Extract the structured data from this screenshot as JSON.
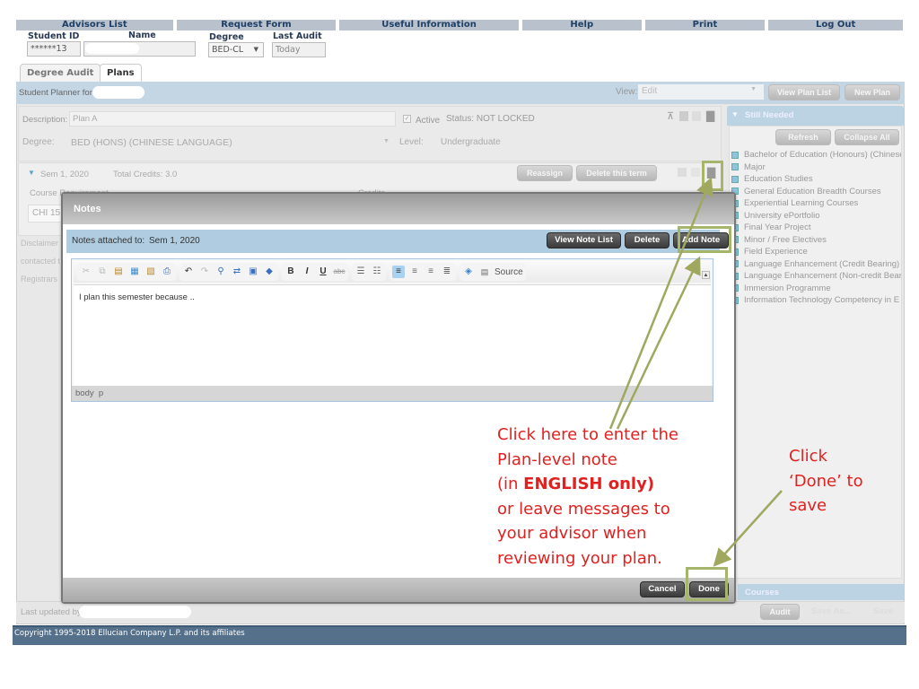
{
  "topnav": [
    "Advisors List",
    "Request Form",
    "Useful Information",
    "Help",
    "Print",
    "Log Out"
  ],
  "student": {
    "id_label": "Student ID",
    "id_value": "******13",
    "name_label": "Name",
    "degree_label": "Degree",
    "degree_value": "BED-CL",
    "last_audit_label": "Last Audit",
    "last_audit_value": "Today"
  },
  "tabs": [
    {
      "label": "Degree Audit",
      "active": false
    },
    {
      "label": "Plans",
      "active": true
    }
  ],
  "planner": {
    "title": "Student Planner for:",
    "view_label": "View:",
    "view_value": "Edit",
    "view_plan_list": "View Plan List",
    "new_plan": "New Plan",
    "description_label": "Description:",
    "description_value": "Plan A",
    "active_label": "Active",
    "status": "Status: NOT LOCKED",
    "degree_label": "Degree:",
    "degree_value": "BED (HONS) (CHINESE LANGUAGE)",
    "level_label": "Level:",
    "level_value": "Undergraduate",
    "term": "Sem 1, 2020",
    "total_credits": "Total Credits: 3.0",
    "reassign": "Reassign",
    "delete_term": "Delete this term",
    "course_header": "Course Requirement",
    "credits_header": "Credits",
    "course_code": "CHI 15",
    "disclaimer_lines": [
      "Disclaimer",
      "contacted t",
      "Registrars"
    ],
    "last_updated": "Last updated by"
  },
  "still_needed": {
    "title": "Still Needed",
    "refresh": "Refresh",
    "collapse_all": "Collapse All",
    "items": [
      "Bachelor of Education (Honours) (Chinese",
      "Major",
      "Education Studies",
      "General Education Breadth Courses",
      "Experiential Learning Courses",
      "University ePortfolio",
      "Final Year Project",
      "Minor / Free Electives",
      "Field Experience",
      "Language Enhancement (Credit Bearing)",
      "Language Enhancement (Non-credit Bear",
      "Immersion Programme",
      "Information Technology Competency in E"
    ],
    "courses_title": "Courses",
    "audit": "Audit",
    "save_as": "Save As...",
    "save": "Save"
  },
  "notes_dialog": {
    "title": "Notes",
    "attached_label": "Notes attached to:",
    "attached_value": "Sem 1, 2020",
    "view_note_list": "View Note List",
    "delete": "Delete",
    "add_note": "Add Note",
    "source": "Source",
    "editor_text": "I plan this semester because ..",
    "path": [
      "body",
      "p"
    ],
    "cancel": "Cancel",
    "done": "Done"
  },
  "annotations": {
    "main_lines": [
      "Click here to enter the",
      "Plan-level note",
      "(in ",
      "ENGLISH only)",
      "or leave messages to",
      "your advisor when",
      "reviewing your plan."
    ],
    "done_lines": [
      "Click",
      "‘Done’ to",
      "save"
    ],
    "color": "#e0211f",
    "arrow_color": "#a0a860"
  },
  "footer": {
    "copyright": "Copyright 1995-2018 Ellucian Company L.P. and its affiliates"
  }
}
